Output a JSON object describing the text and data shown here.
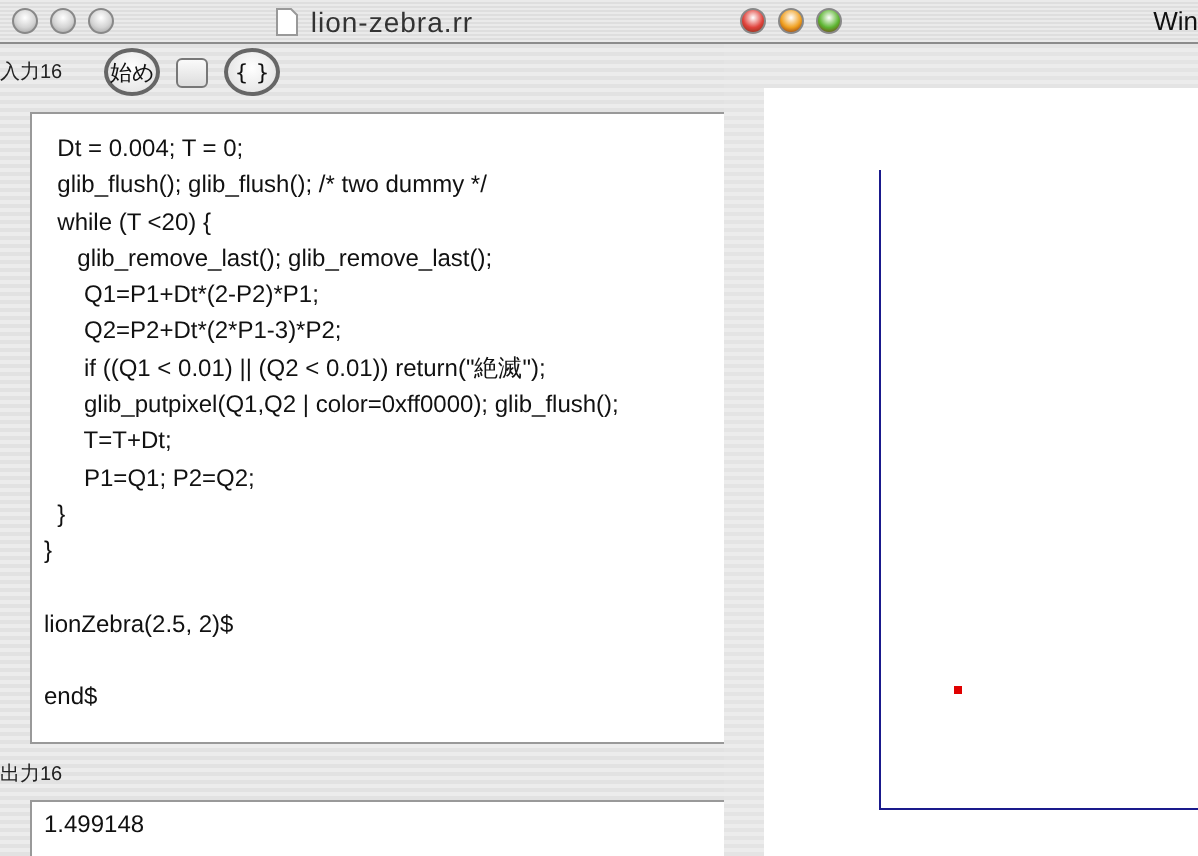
{
  "editor_window": {
    "title": "lion-zebra.rr",
    "active": false,
    "input_label": "入力16",
    "toolbar": [
      {
        "kind": "round",
        "label": "始め"
      },
      {
        "kind": "square"
      },
      {
        "kind": "round",
        "label": "{ }"
      }
    ],
    "code_blocks": [
      [
        "  Dt = 0.004; T = 0;",
        "  glib_flush(); glib_flush(); /* two dummy */",
        "  while (T <20) {",
        "     glib_remove_last(); glib_remove_last();",
        "      Q1=P1+Dt*(2-P2)*P1;",
        "      Q2=P2+Dt*(2*P1-3)*P2;",
        "      if ((Q1 < 0.01) || (Q2 < 0.01)) return(\"絶滅\");",
        "      glib_putpixel(Q1,Q2 | color=0xff0000); glib_flush();",
        "      T=T+Dt;",
        "      P1=Q1; P2=Q2;",
        "  }",
        "}"
      ],
      [
        "lionZebra(2.5, 2)$"
      ],
      [
        "end$"
      ]
    ],
    "output_label": "出力16",
    "output": "1.499148"
  },
  "graph_window": {
    "title": "Win",
    "active": true
  }
}
